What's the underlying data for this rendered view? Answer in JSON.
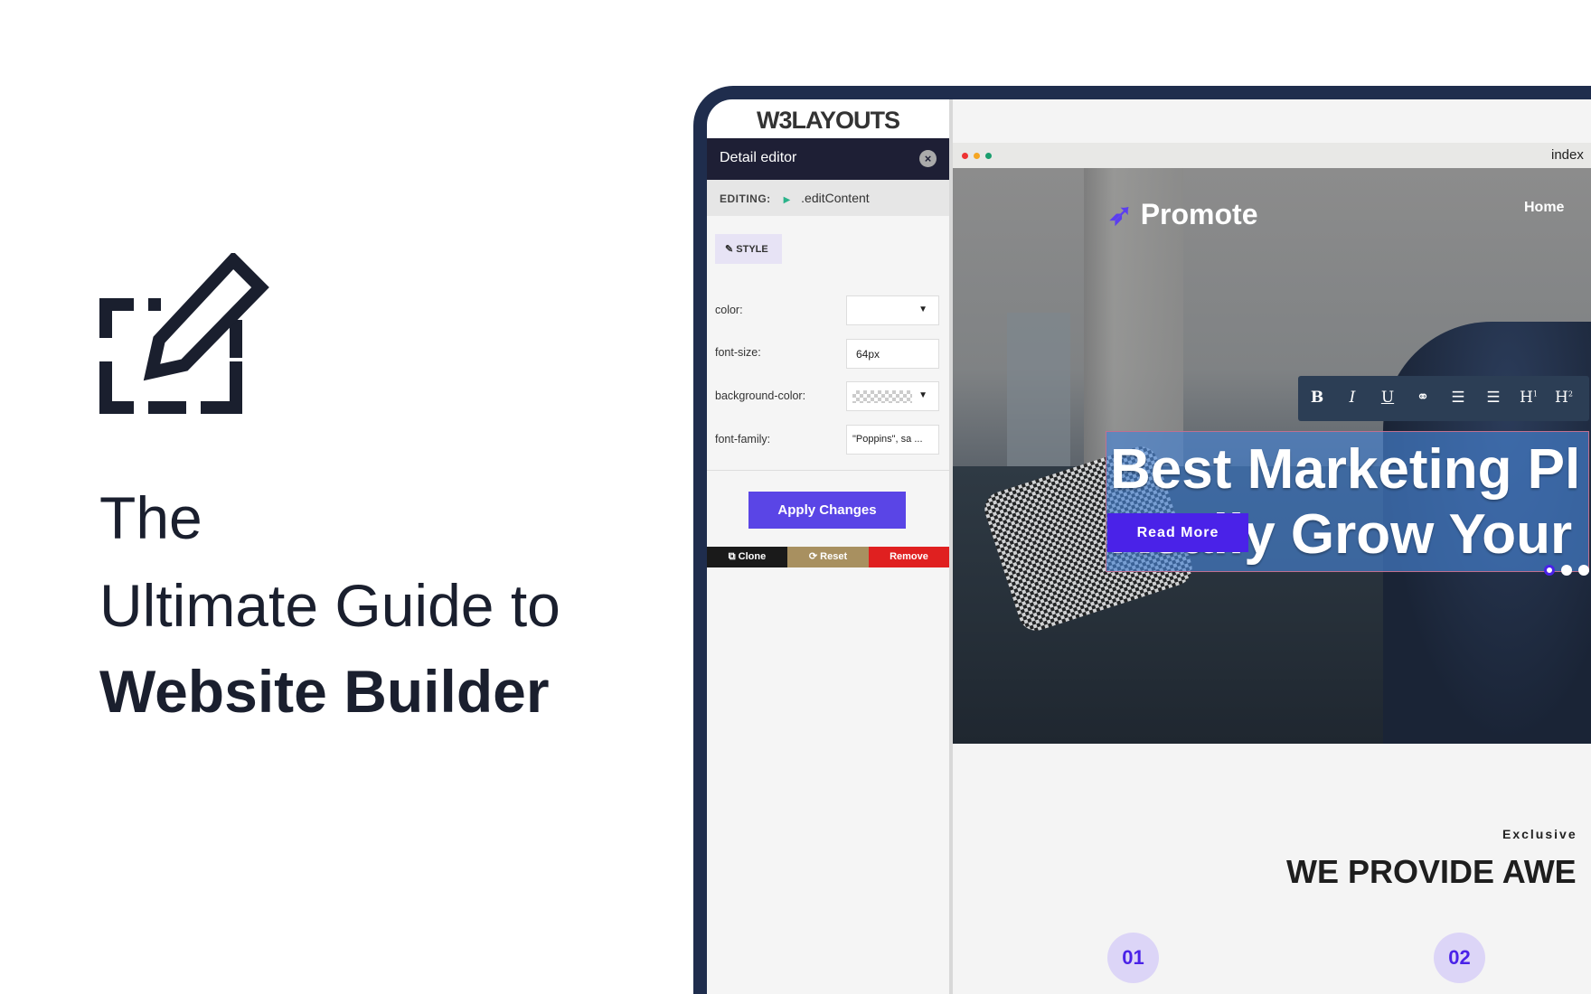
{
  "promo": {
    "line1": "The",
    "line2": "Ultimate Guide to",
    "line3": "Website Builder",
    "icon": "edit-selection-icon"
  },
  "builder": {
    "logo": "W3LAYOUTS",
    "devices": [
      "mobile-icon",
      "tablet-icon",
      "desktop-icon"
    ],
    "panel": {
      "title": "Detail editor",
      "editing_label": "EDITING:",
      "editing_target": ".editContent",
      "style_tab": "STYLE",
      "fields": [
        {
          "label": "color:",
          "value": ""
        },
        {
          "label": "font-size:",
          "value": "64px"
        },
        {
          "label": "background-color:",
          "value": ""
        },
        {
          "label": "font-family:",
          "value": "\"Poppins\", sa ..."
        }
      ],
      "apply": "Apply Changes",
      "clone": "Clone",
      "reset": "Reset",
      "remove": "Remove",
      "colors": {
        "clone": "#1a1a1a",
        "reset": "#a89060",
        "remove": "#e02020",
        "apply": "#5a45e6"
      }
    },
    "preview": {
      "tab": "index",
      "brand": "Promote",
      "nav": [
        "Home"
      ],
      "toolbar": [
        "B",
        "I",
        "U",
        "link",
        "ol",
        "ul",
        "H1",
        "H2"
      ],
      "headline1": "Best Marketing Pl",
      "headline2": "Really Grow Your",
      "cta": "Read More",
      "eyebrow": "Exclusive",
      "section_title": "WE PROVIDE AWE",
      "steps": [
        "01",
        "02"
      ]
    }
  }
}
